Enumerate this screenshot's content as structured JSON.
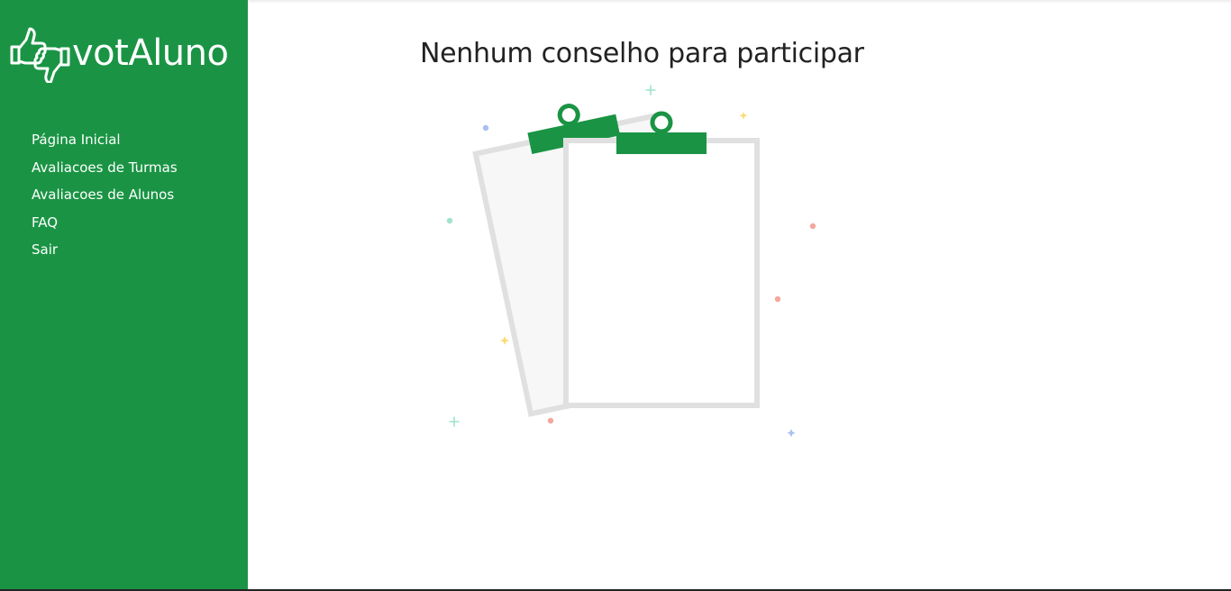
{
  "app": {
    "logo_text": "votAluno",
    "brand_color": "#1a9444"
  },
  "sidebar": {
    "items": [
      {
        "label": "Página Inicial"
      },
      {
        "label": "Avaliacoes de Turmas"
      },
      {
        "label": "Avaliacoes de Alunos"
      },
      {
        "label": "FAQ"
      },
      {
        "label": "Sair"
      }
    ]
  },
  "main": {
    "title": "Nenhum conselho para participar"
  },
  "icons": {
    "logo": "thumbs-up-down-icon",
    "empty_state": "clipboards-illustration"
  }
}
